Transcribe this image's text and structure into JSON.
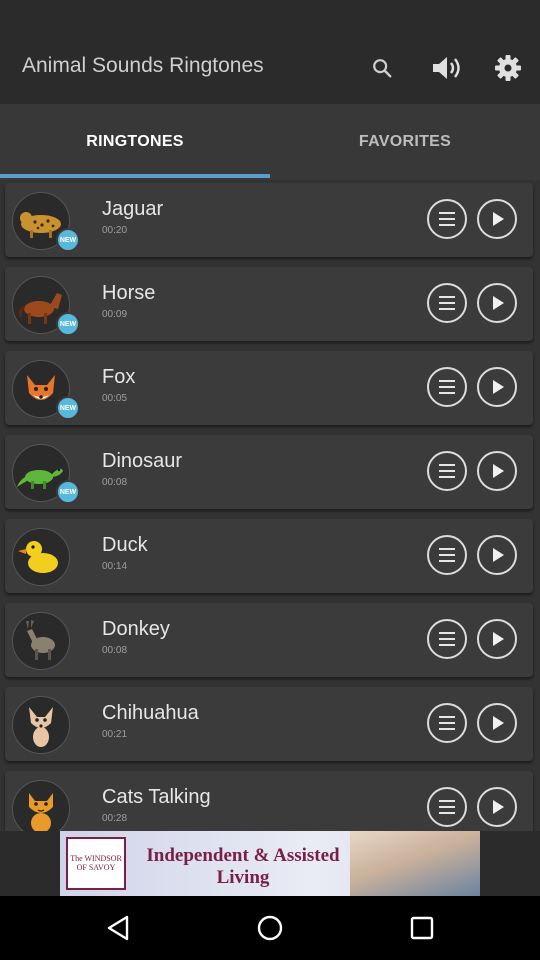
{
  "app": {
    "title": "Animal Sounds Ringtones"
  },
  "toolbar": {
    "search_icon": "search-icon",
    "volume_icon": "volume-icon",
    "settings_icon": "gear-icon"
  },
  "tabs": [
    {
      "label": "RINGTONES",
      "active": true
    },
    {
      "label": "FAVORITES",
      "active": false
    }
  ],
  "colors": {
    "accent": "#5a9dd0",
    "badge": "#58b8dc",
    "appbar": "#2b2b2b",
    "tabs": "#383838"
  },
  "ringtones": [
    {
      "name": "Jaguar",
      "duration": "00:20",
      "is_new": true,
      "badge": "NEW",
      "icon": "jaguar-icon"
    },
    {
      "name": "Horse",
      "duration": "00:09",
      "is_new": true,
      "badge": "NEW",
      "icon": "horse-icon"
    },
    {
      "name": "Fox",
      "duration": "00:05",
      "is_new": true,
      "badge": "NEW",
      "icon": "fox-icon"
    },
    {
      "name": "Dinosaur",
      "duration": "00:08",
      "is_new": true,
      "badge": "NEW",
      "icon": "dinosaur-icon"
    },
    {
      "name": "Duck",
      "duration": "00:14",
      "is_new": false,
      "icon": "duck-icon"
    },
    {
      "name": "Donkey",
      "duration": "00:08",
      "is_new": false,
      "icon": "donkey-icon"
    },
    {
      "name": "Chihuahua",
      "duration": "00:21",
      "is_new": false,
      "icon": "chihuahua-icon"
    },
    {
      "name": "Cats Talking",
      "duration": "00:28",
      "is_new": false,
      "icon": "cat-icon"
    }
  ],
  "ad": {
    "logo_text": "The WINDSOR OF SAVOY",
    "headline": "Independent & Assisted Living"
  },
  "navbar": {
    "back_icon": "back-icon",
    "home_icon": "home-icon",
    "recents_icon": "recents-icon"
  }
}
